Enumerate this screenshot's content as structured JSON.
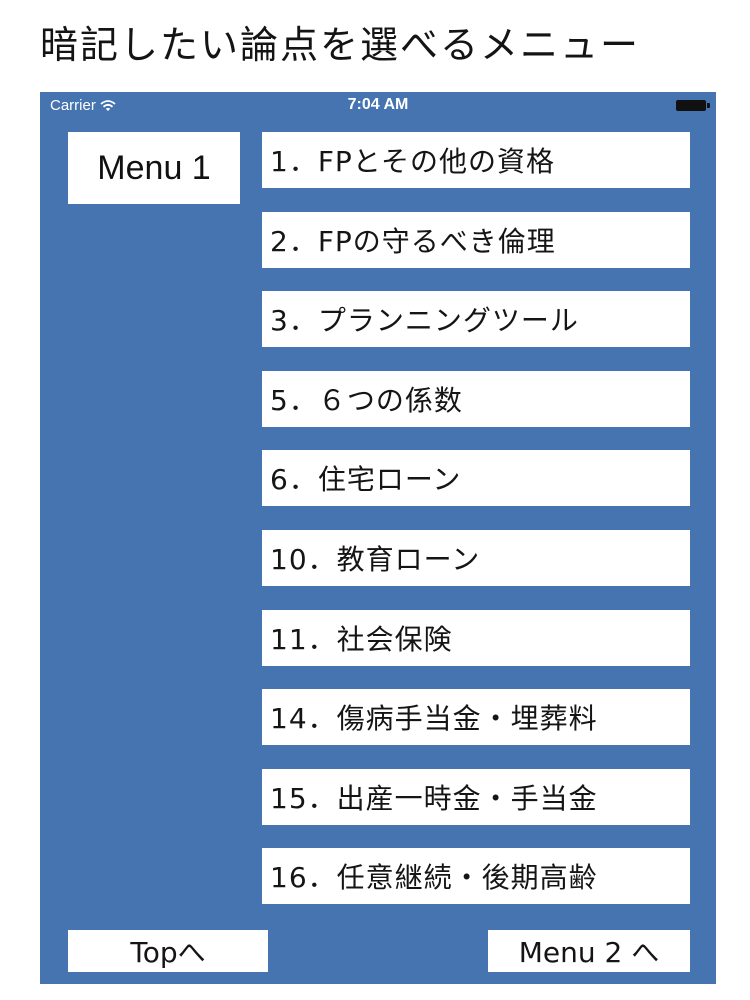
{
  "slide": {
    "title": "暗記したい論点を選べるメニュー"
  },
  "status_bar": {
    "carrier": "Carrier",
    "time": "7:04 AM"
  },
  "screen": {
    "menu_label": "Menu 1",
    "items": [
      {
        "label": "1．FPとその他の資格"
      },
      {
        "label": "2．FPの守るべき倫理"
      },
      {
        "label": "3．プランニングツール"
      },
      {
        "label": "5．６つの係数"
      },
      {
        "label": "6．住宅ローン"
      },
      {
        "label": "10．教育ローン"
      },
      {
        "label": "11．社会保険"
      },
      {
        "label": "14．傷病手当金・埋葬料"
      },
      {
        "label": "15．出産一時金・手当金"
      },
      {
        "label": "16．任意継続・後期高齢"
      }
    ],
    "top_button": "Topへ",
    "menu2_button": "Menu 2 へ"
  },
  "colors": {
    "screen_background": "#4674b0",
    "button_background": "#ffffff"
  },
  "icons": {
    "wifi": "wifi-icon",
    "battery": "battery-icon"
  }
}
